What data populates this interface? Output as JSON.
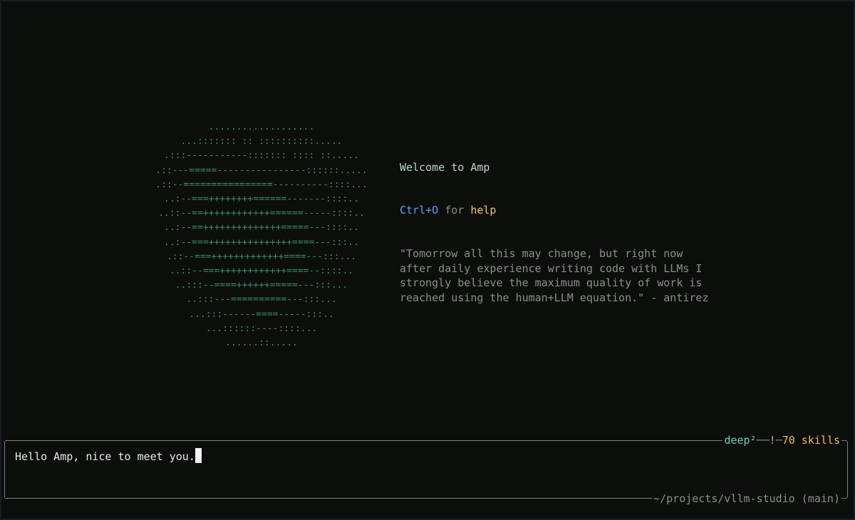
{
  "splash": {
    "ascii_art": "...................\n...::::::: :: ::::::::::.....\n.:::-----------::::::: :::: ::.....\n.::---=====----------------::::::.....\n.::--================----------::::...\n..:--===++++++++======-------::::..\n..::--==++++++++++++======-----::::..\n..:--==++++++++++++++=====---::::..\n..:--===+++++++++++++++====---:::..\n.::--===+++++++++++++====---:::...\n..::--===++++++++++++====--::::..\n..:::--====++++++=====---:::...\n..:::---==========---:::...\n...:::------====-----:::..\n...::::::----::::...\n......::....."
  },
  "welcome": {
    "title": "Welcome to Amp",
    "help_key": "Ctrl+O",
    "help_mid": " for ",
    "help_word": "help",
    "quote": "\"Tomorrow all this may change, but right now\nafter daily experience writing code with LLMs I\nstrongly believe the maximum quality of work is\nreached using the human+LLM equation.\" - antirez"
  },
  "input": {
    "value": "Hello Amp, nice to meet you.",
    "mode": "deep²",
    "warning": "!",
    "skills": "70 skills",
    "path": "~/projects/vllm-studio (main)"
  },
  "colors": {
    "background": "#0c0e0c",
    "ascii_green": "#3d8a6a",
    "welcome_text": "#b9d6c6",
    "help_key_blue": "#5b9cf0",
    "help_word_orange": "#f2c07a",
    "dim_text": "#8a8f8c",
    "mode_teal": "#6fcfb2",
    "skills_orange": "#f0b870"
  }
}
